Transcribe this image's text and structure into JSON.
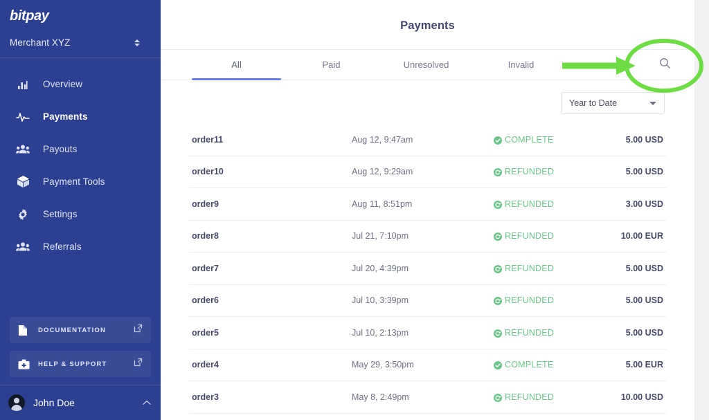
{
  "sidebar": {
    "brand": "bitpay",
    "merchant": "Merchant XYZ",
    "items": [
      {
        "label": "Overview",
        "icon": "bar-chart-icon"
      },
      {
        "label": "Payments",
        "icon": "activity-pulse-icon"
      },
      {
        "label": "Payouts",
        "icon": "people-icon"
      },
      {
        "label": "Payment Tools",
        "icon": "cube-icon"
      },
      {
        "label": "Settings",
        "icon": "gear-icon"
      },
      {
        "label": "Referrals",
        "icon": "people-icon"
      }
    ],
    "documentation": "DOCUMENTATION",
    "help": "HELP & SUPPORT",
    "user": "John Doe"
  },
  "header": {
    "title": "Payments"
  },
  "tabs": [
    {
      "label": "All"
    },
    {
      "label": "Paid"
    },
    {
      "label": "Unresolved"
    },
    {
      "label": "Invalid"
    }
  ],
  "search": {
    "icon": "search-icon"
  },
  "filter": {
    "selected": "Year to Date"
  },
  "table": {
    "rows": [
      {
        "order": "order11",
        "date": "Aug 12, 9:47am",
        "status": "COMPLETE",
        "status_icon": "check-circle-icon",
        "amount": "5.00 USD"
      },
      {
        "order": "order10",
        "date": "Aug 12, 9:29am",
        "status": "REFUNDED",
        "status_icon": "refund-circle-icon",
        "amount": "5.00 USD"
      },
      {
        "order": "order9",
        "date": "Aug 11, 8:51pm",
        "status": "REFUNDED",
        "status_icon": "refund-circle-icon",
        "amount": "3.00 USD"
      },
      {
        "order": "order8",
        "date": "Jul 21, 7:10pm",
        "status": "REFUNDED",
        "status_icon": "refund-circle-icon",
        "amount": "10.00 EUR"
      },
      {
        "order": "order7",
        "date": "Jul 20, 4:39pm",
        "status": "REFUNDED",
        "status_icon": "refund-circle-icon",
        "amount": "5.00 USD"
      },
      {
        "order": "order6",
        "date": "Jul 10, 3:39pm",
        "status": "REFUNDED",
        "status_icon": "refund-circle-icon",
        "amount": "5.00 USD"
      },
      {
        "order": "order5",
        "date": "Jul 10, 2:13pm",
        "status": "REFUNDED",
        "status_icon": "refund-circle-icon",
        "amount": "5.00 USD"
      },
      {
        "order": "order4",
        "date": "May 29, 3:50pm",
        "status": "COMPLETE",
        "status_icon": "check-circle-icon",
        "amount": "5.00 EUR"
      },
      {
        "order": "order3",
        "date": "May 8, 2:49pm",
        "status": "REFUNDED",
        "status_icon": "refund-circle-icon",
        "amount": "10.00 USD"
      }
    ]
  },
  "annotation": {
    "color": "#6ddc45",
    "shapes": [
      "arrow-pointing-right",
      "ellipse-highlight-around-search-icon"
    ]
  },
  "colors": {
    "sidebar": "#2c3f90",
    "accent": "#6b7ce8",
    "status_green": "#6dc48a",
    "annotation_green": "#6ddc45"
  }
}
